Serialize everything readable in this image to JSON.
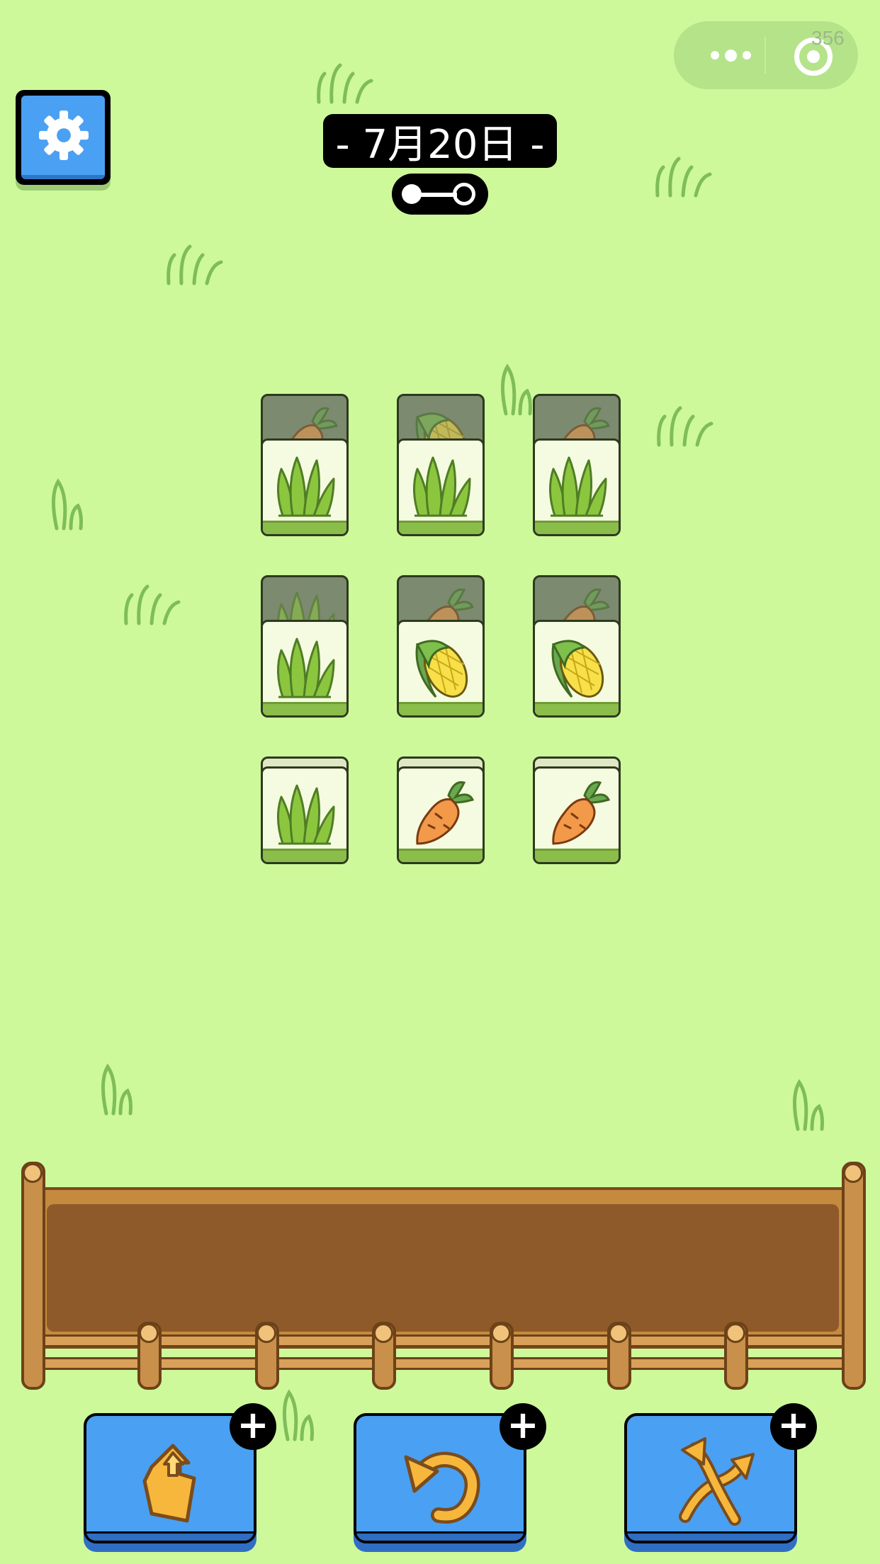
{
  "status": {
    "fps": "356"
  },
  "capsule": {
    "more_icon": "more-dots-icon",
    "close_icon": "target-close-icon"
  },
  "header": {
    "date": "- 7月20日 -",
    "progress_level": 0.0
  },
  "settings": {
    "icon": "gear-icon"
  },
  "board": {
    "rows": [
      [
        {
          "top": "grass",
          "under": "carrot"
        },
        {
          "top": "grass",
          "under": "corn"
        },
        {
          "top": "grass",
          "under": "carrot"
        }
      ],
      [
        {
          "top": "grass",
          "under": "grass"
        },
        {
          "top": "corn",
          "under": "carrot"
        },
        {
          "top": "corn",
          "under": "carrot"
        }
      ],
      [
        {
          "top": "grass",
          "under": "none"
        },
        {
          "top": "carrot",
          "under": "none"
        },
        {
          "top": "carrot",
          "under": "none"
        }
      ]
    ]
  },
  "tray": {
    "slots": 7,
    "contents": []
  },
  "powerups": [
    {
      "name": "lift-out",
      "icon": "lift-tiles-icon",
      "badge": "+"
    },
    {
      "name": "undo",
      "icon": "undo-arrow-icon",
      "badge": "+"
    },
    {
      "name": "shuffle",
      "icon": "shuffle-arrows-icon",
      "badge": "+"
    }
  ],
  "colors": {
    "background": "#cdf99b",
    "button_blue": "#4aa0f2",
    "tray_wood": "#8e5a2a"
  }
}
